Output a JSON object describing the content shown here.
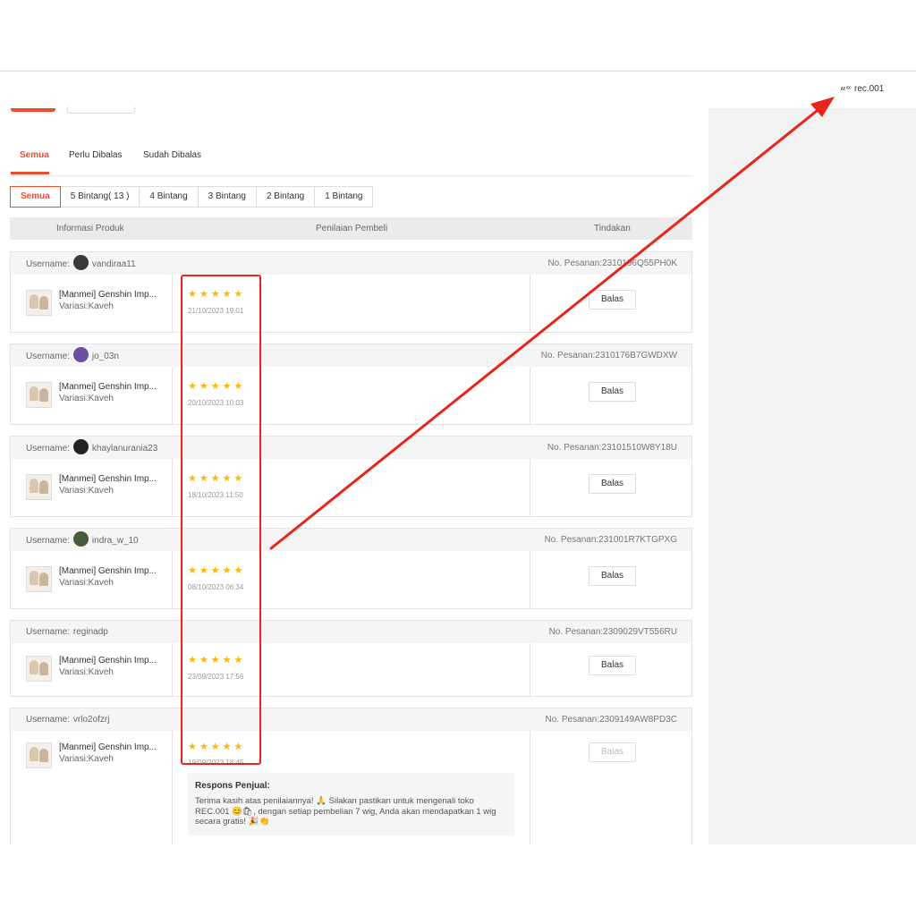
{
  "header": {
    "shop_logo_text": "ᴍ.ʳᵉᶜ",
    "shop_name": "rec.001"
  },
  "tabs": [
    {
      "label": "Semua",
      "active": true
    },
    {
      "label": "Perlu Dibalas",
      "active": false
    },
    {
      "label": "Sudah Dibalas",
      "active": false
    }
  ],
  "filters": [
    {
      "label": "Semua",
      "active": true
    },
    {
      "label": "5 Bintang( 13 )",
      "active": false
    },
    {
      "label": "4 Bintang",
      "active": false
    },
    {
      "label": "3 Bintang",
      "active": false
    },
    {
      "label": "2 Bintang",
      "active": false
    },
    {
      "label": "1 Bintang",
      "active": false
    }
  ],
  "table_headers": {
    "product": "Informasi Produk",
    "rating": "Penilaian Pembeli",
    "action": "Tindakan"
  },
  "reviews": [
    {
      "username_label": "Username:",
      "username": "vandiraa11",
      "order": "No. Pesanan:2310196Q55PH0K",
      "product_name": "[Manmei] Genshin Imp...",
      "variation": "Variasi:Kaveh",
      "stars": "★★★★★",
      "date": "21/10/2023 19:01",
      "action": "Balas"
    },
    {
      "username_label": "Username:",
      "username": "jo_03n",
      "order": "No. Pesanan:2310176B7GWDXW",
      "product_name": "[Manmei] Genshin Imp...",
      "variation": "Variasi:Kaveh",
      "stars": "★★★★★",
      "date": "20/10/2023 10:03",
      "action": "Balas"
    },
    {
      "username_label": "Username:",
      "username": "khaylanurania23",
      "order": "No. Pesanan:23101510W8Y18U",
      "product_name": "[Manmei] Genshin Imp...",
      "variation": "Variasi:Kaveh",
      "stars": "★★★★★",
      "date": "18/10/2023 11:50",
      "action": "Balas"
    },
    {
      "username_label": "Username:",
      "username": "indra_w_10",
      "order": "No. Pesanan:231001R7KTGPXG",
      "product_name": "[Manmei] Genshin Imp...",
      "variation": "Variasi:Kaveh",
      "stars": "★★★★★",
      "date": "08/10/2023 06:34",
      "action": "Balas"
    },
    {
      "username_label": "Username:",
      "username": "reginadp",
      "order": "No. Pesanan:2309029VT556RU",
      "product_name": "[Manmei] Genshin Imp...",
      "variation": "Variasi:Kaveh",
      "stars": "★★★★★",
      "date": "23/09/2023 17:56",
      "action": "Balas"
    },
    {
      "username_label": "Username:",
      "username": "vrlo2ofzrj",
      "order": "No. Pesanan:2309149AW8PD3C",
      "product_name": "[Manmei] Genshin Imp...",
      "variation": "Variasi:Kaveh",
      "stars": "★★★★★",
      "date": "19/09/2023 18:45",
      "action": "Balas",
      "response_title": "Respons Penjual:",
      "response_text": "Terima kasih atas penilaiannya! 🙏 Silakan pastikan untuk mengenali toko REC.001 😊🛍, dengan setiap pembelian 7 wig, Anda akan mendapatkan 1 wig secara gratis! 🎉👏"
    }
  ],
  "colors": {
    "accent": "#ee4d2d",
    "star": "#ffb800",
    "annotation": "#e8241c"
  }
}
